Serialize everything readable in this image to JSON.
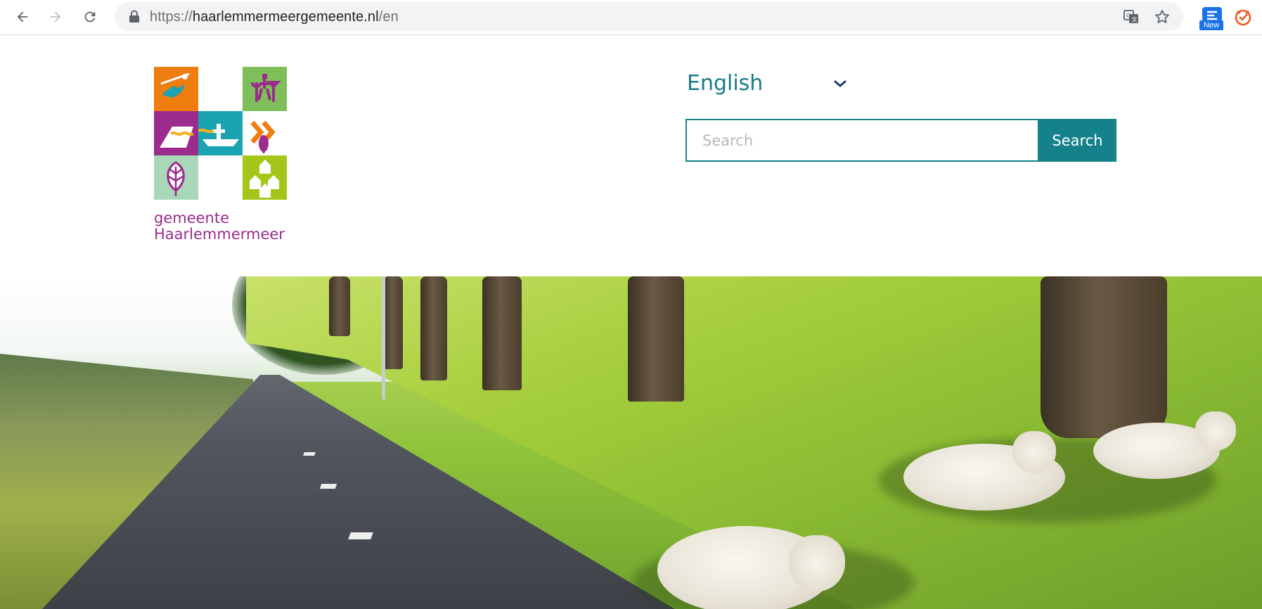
{
  "browser": {
    "url_scheme": "https://",
    "url_host": "haarlemmermeergemeente.nl",
    "url_path": "/en",
    "extension_badge": "New",
    "icons": [
      "back-icon",
      "forward-icon",
      "reload-icon",
      "lock-icon",
      "translate-icon",
      "star-icon",
      "extension-icon",
      "tampermonkey-icon"
    ]
  },
  "header": {
    "logo_line1": "gemeente",
    "logo_line2": "Haarlemmermeer",
    "language": "English",
    "search_placeholder": "Search",
    "search_button": "Search"
  },
  "colors": {
    "brand_teal": "#14818b",
    "language_text": "#1a7a8a",
    "logo_text": "#9b2b8d"
  }
}
